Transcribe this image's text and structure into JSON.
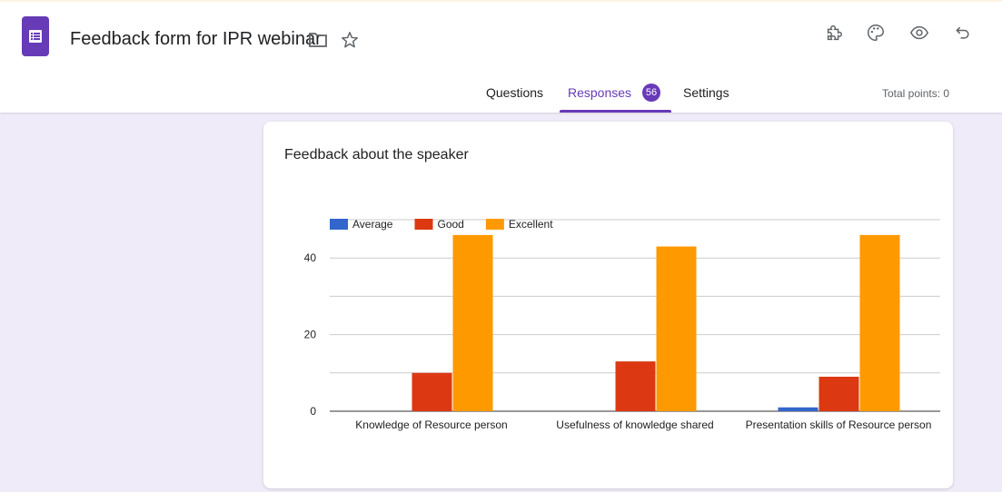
{
  "header": {
    "title": "Feedback form for IPR webinar",
    "icons": [
      "forms-app-icon",
      "folder-icon",
      "star-icon",
      "addon-puzzle-icon",
      "palette-icon",
      "preview-eye-icon",
      "undo-icon"
    ]
  },
  "tabs": {
    "questions": "Questions",
    "responses": "Responses",
    "responses_count": "56",
    "settings": "Settings",
    "total_points": "Total points: 0"
  },
  "colors": {
    "accent": "#673ab7",
    "background": "#f0ebf8",
    "average": "#3366cc",
    "good": "#dc3912",
    "excellent": "#ff9900"
  },
  "card": {
    "title": "Feedback about the speaker"
  },
  "chart_data": {
    "type": "bar",
    "title": "Feedback about the speaker",
    "categories": [
      "Knowledge of Resource person",
      "Usefulness of knowledge shared",
      "Presentation skills of Resource person"
    ],
    "series": [
      {
        "name": "Average",
        "values": [
          0,
          0,
          1
        ]
      },
      {
        "name": "Good",
        "values": [
          10,
          13,
          9
        ]
      },
      {
        "name": "Excellent",
        "values": [
          46,
          43,
          46
        ]
      }
    ],
    "yticks": [
      "0",
      "20",
      "40"
    ],
    "ylim": [
      0,
      50
    ],
    "grid": true,
    "legend": "top-left"
  }
}
